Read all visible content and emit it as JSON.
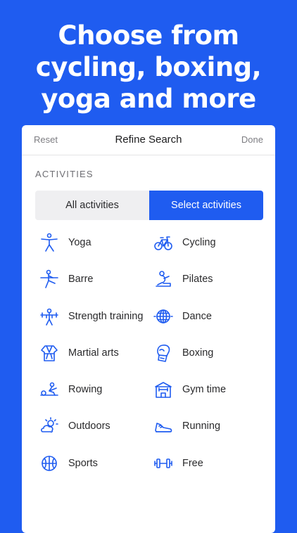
{
  "headline": [
    "Choose from",
    "cycling, boxing,",
    "yoga and more"
  ],
  "topbar": {
    "reset": "Reset",
    "title": "Refine Search",
    "done": "Done"
  },
  "section_label": "ACTIVITIES",
  "segment": {
    "all": "All activities",
    "select": "Select activities",
    "selected": "select"
  },
  "activities": [
    {
      "label": "Yoga",
      "icon": "yoga-icon"
    },
    {
      "label": "Cycling",
      "icon": "cycling-icon"
    },
    {
      "label": "Barre",
      "icon": "barre-icon"
    },
    {
      "label": "Pilates",
      "icon": "pilates-icon"
    },
    {
      "label": "Strength training",
      "icon": "strength-icon"
    },
    {
      "label": "Dance",
      "icon": "disco-ball-icon"
    },
    {
      "label": "Martial arts",
      "icon": "martial-arts-icon"
    },
    {
      "label": "Boxing",
      "icon": "boxing-glove-icon"
    },
    {
      "label": "Rowing",
      "icon": "rowing-icon"
    },
    {
      "label": "Gym time",
      "icon": "gym-icon"
    },
    {
      "label": "Outdoors",
      "icon": "sun-cloud-icon"
    },
    {
      "label": "Running",
      "icon": "running-shoe-icon"
    },
    {
      "label": "Sports",
      "icon": "ball-icon"
    },
    {
      "label": "Free",
      "icon": "dumbbell-icon"
    }
  ],
  "colors": {
    "brand": "#1f5cf0",
    "card": "#ffffff",
    "segment_off": "#efeff1"
  }
}
